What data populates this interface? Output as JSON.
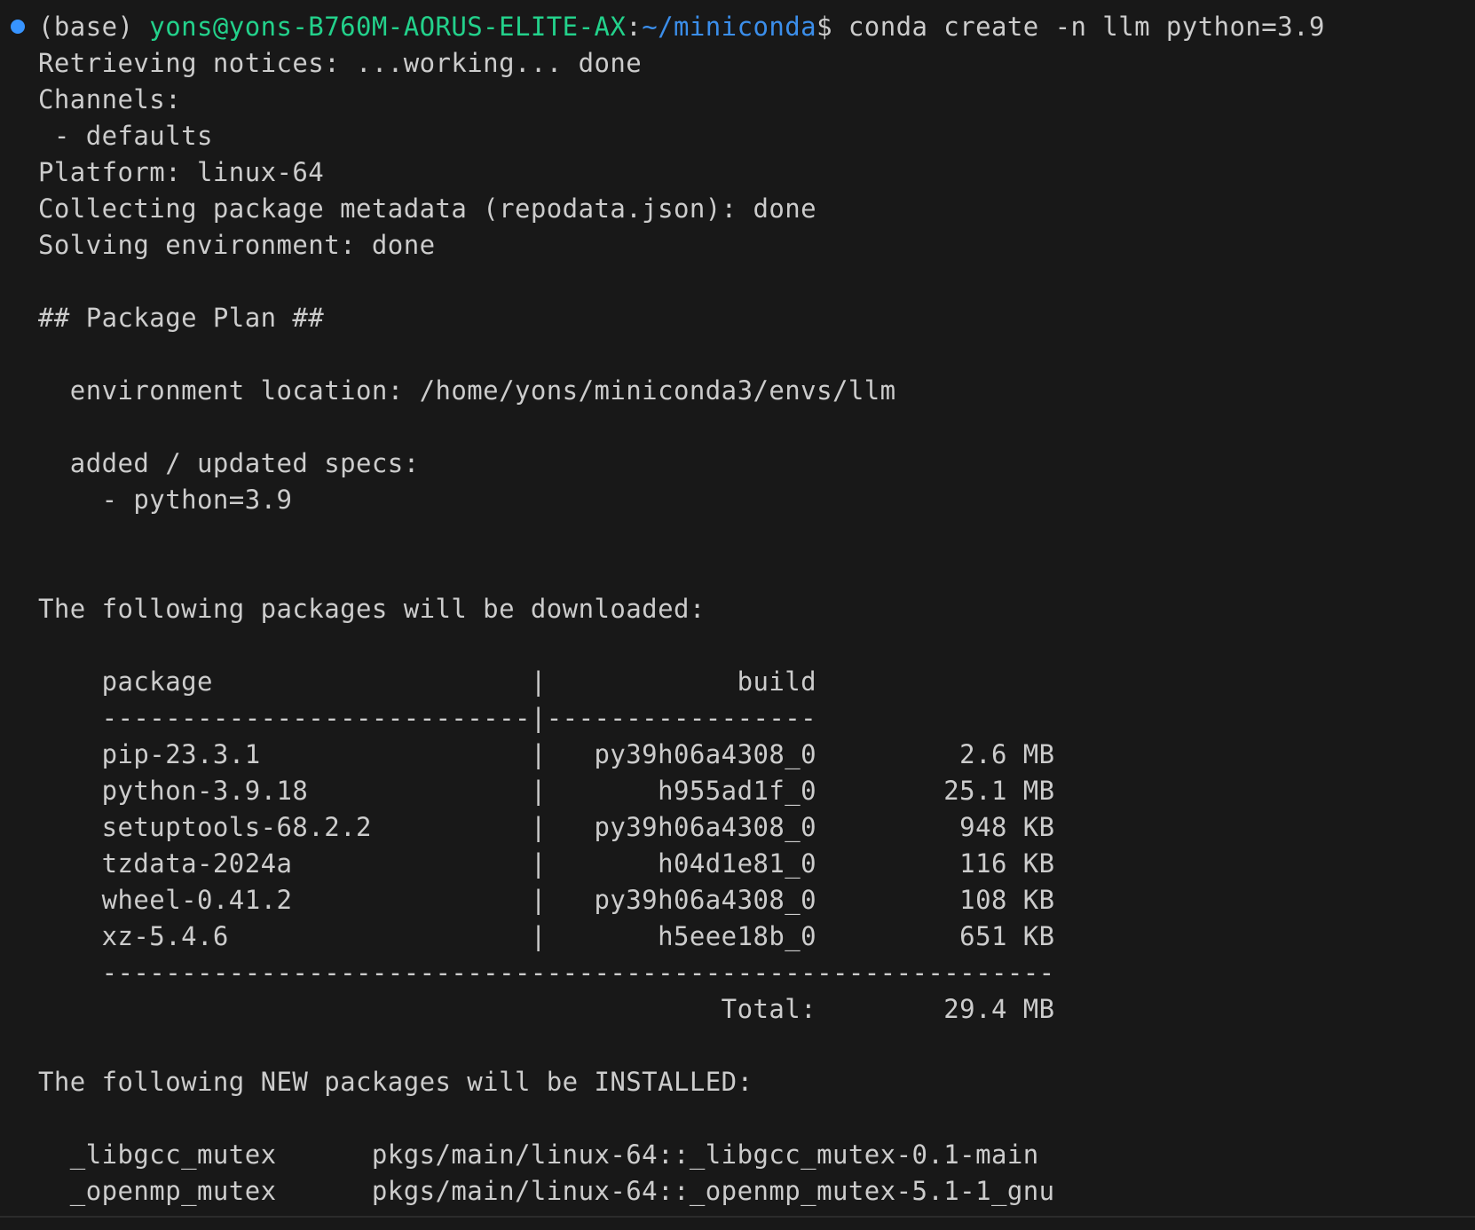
{
  "prompt": {
    "env": "(base) ",
    "user_host": "yons@yons-B760M-AORUS-ELITE-AX",
    "colon": ":",
    "cwd": "~/miniconda",
    "symbol": "$ ",
    "command": "conda create -n llm python=3.9"
  },
  "colors": {
    "background": "#181818",
    "foreground": "#cccccc",
    "user_host": "#23d18b",
    "path": "#3b8eea",
    "status_dot": "#3794ff"
  },
  "output": {
    "retrieving": "Retrieving notices: ...working... done",
    "channels_label": "Channels:",
    "channel_default": " - defaults",
    "platform": "Platform: linux-64",
    "collecting": "Collecting package metadata (repodata.json): done",
    "solving": "Solving environment: done",
    "plan_heading": "## Package Plan ##",
    "env_location": "  environment location: /home/yons/miniconda3/envs/llm",
    "specs_label": "  added / updated specs:",
    "spec_python": "    - python=3.9",
    "download_heading": "The following packages will be downloaded:",
    "install_heading": "The following NEW packages will be INSTALLED:"
  },
  "download_table": {
    "header": "    package                    |            build",
    "separator": "    ---------------------------|-----------------",
    "rows": [
      "    pip-23.3.1                 |   py39h06a4308_0         2.6 MB",
      "    python-3.9.18              |       h955ad1f_0        25.1 MB",
      "    setuptools-68.2.2          |   py39h06a4308_0         948 KB",
      "    tzdata-2024a               |       h04d1e81_0         116 KB",
      "    wheel-0.41.2               |   py39h06a4308_0         108 KB",
      "    xz-5.4.6                   |       h5eee18b_0         651 KB"
    ],
    "footer_separator": "    ------------------------------------------------------------",
    "total": "                                           Total:        29.4 MB"
  },
  "install_list": [
    "  _libgcc_mutex      pkgs/main/linux-64::_libgcc_mutex-0.1-main",
    "  _openmp_mutex      pkgs/main/linux-64::_openmp_mutex-5.1-1_gnu"
  ]
}
